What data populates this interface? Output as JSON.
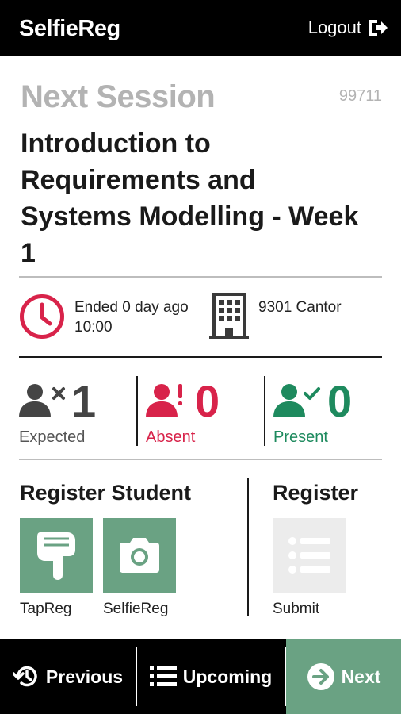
{
  "app": {
    "title": "SelfieReg"
  },
  "header": {
    "logout_label": "Logout"
  },
  "session": {
    "heading": "Next Session",
    "id": "99711",
    "title": "Introduction to Requirements and Systems Modelling - Week 1",
    "status": "Ended 0 day ago",
    "time": "10:00",
    "room": "9301 Cantor"
  },
  "stats": {
    "expected": {
      "count": "1",
      "label": "Expected"
    },
    "absent": {
      "count": "0",
      "label": "Absent"
    },
    "present": {
      "count": "0",
      "label": "Present"
    }
  },
  "register_student": {
    "title": "Register Student",
    "options": [
      {
        "label": "TapReg"
      },
      {
        "label": "SelfieReg"
      }
    ]
  },
  "register": {
    "title": "Register",
    "submit_label": "Submit"
  },
  "nav": {
    "previous": "Previous",
    "upcoming": "Upcoming",
    "next": "Next"
  },
  "colors": {
    "accent_green": "#6aa283",
    "alert_red": "#d8234a",
    "present_green": "#1e8a5e",
    "muted": "#b3b3b3"
  },
  "icons": [
    "logout-icon",
    "clock-icon",
    "building-icon",
    "user-x-icon",
    "user-alert-icon",
    "user-check-icon",
    "tap-hand-icon",
    "camera-icon",
    "list-icon",
    "history-icon",
    "menu-list-icon",
    "arrow-right-circle-icon"
  ]
}
